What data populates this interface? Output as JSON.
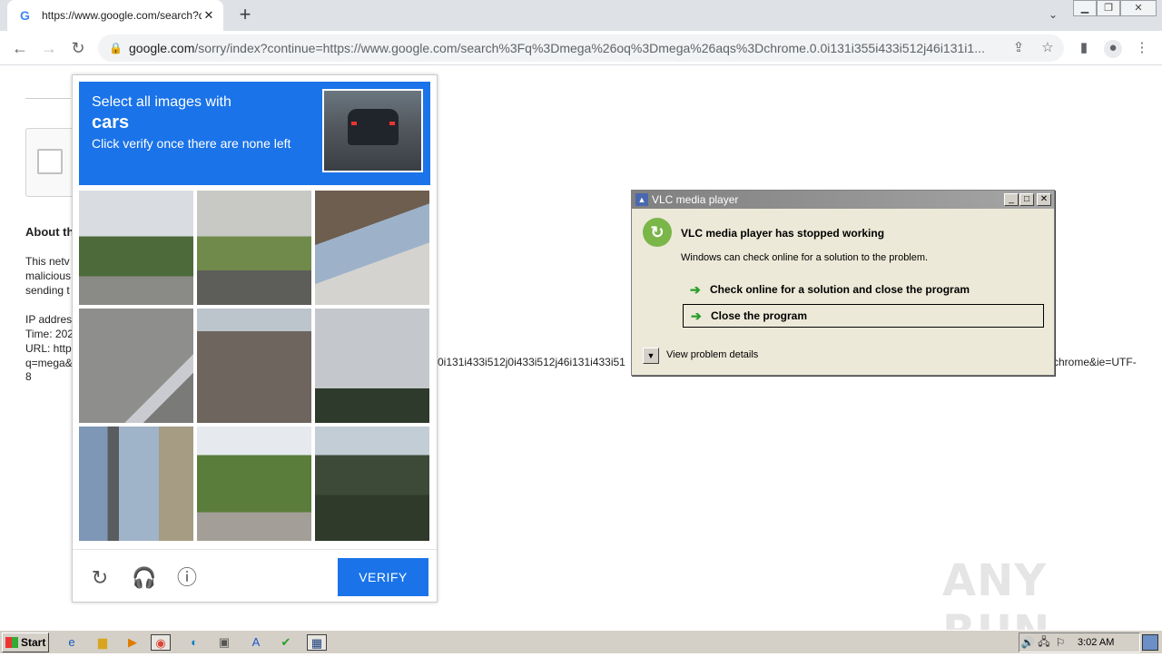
{
  "browser": {
    "tab_title": "https://www.google.com/search?q=",
    "tab_favicon": "G",
    "new_tab": "+",
    "url_host": "google.com",
    "url_rest": "/sorry/index?continue=https://www.google.com/search%3Fq%3Dmega%26oq%3Dmega%26aqs%3Dchrome.0.0i131i355i433i512j46i131i1..."
  },
  "page": {
    "about_heading": "About th",
    "para1": [
      "This netv",
      "malicious",
      "sending t"
    ],
    "para2": [
      "IP addres",
      "Time: 202",
      "URL: http",
      "q=mega&"
    ],
    "url_frag_mid": "0i131i433i512j0i433i512j46i131i433i51",
    "url_frag_right": "chrome&ie=UTF-",
    "url_frag_end": "8"
  },
  "captcha": {
    "line1": "Select all images with",
    "line2": "cars",
    "line3": "Click verify once there are none left",
    "verify_label": "VERIFY",
    "reload_icon": "↻",
    "audio_icon": "🎧",
    "info_icon": "ⓘ"
  },
  "vlc": {
    "title": "VLC media player",
    "heading": "VLC media player has stopped working",
    "sub": "Windows can check online for a solution to the problem.",
    "option1": "Check online for a solution and close the program",
    "option2": "Close the program",
    "details": "View problem details",
    "min": "_",
    "max": "□",
    "close": "✕"
  },
  "watermark": "ANY RUN",
  "taskbar": {
    "start_label": "Start",
    "clock": "3:02 AM"
  }
}
